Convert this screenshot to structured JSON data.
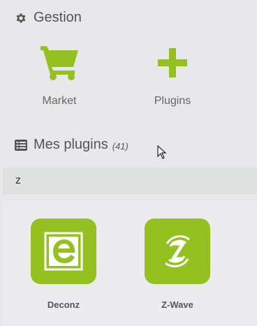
{
  "gestion": {
    "title": "Gestion",
    "icon": "gear-icon",
    "actions": [
      {
        "label": "Market",
        "icon": "shopping-cart-icon"
      },
      {
        "label": "Plugins",
        "icon": "plus-icon"
      }
    ]
  },
  "plugins_section": {
    "title": "Mes plugins",
    "count": "(41)",
    "icon": "list-icon"
  },
  "search": {
    "value": "z"
  },
  "plugin_list": [
    {
      "name": "Deconz",
      "icon": "deconz-logo-icon"
    },
    {
      "name": "Z-Wave",
      "icon": "zwave-logo-icon"
    }
  ],
  "colors": {
    "accent": "#94c11f",
    "background": "#e8e8ea",
    "text": "#555555"
  }
}
